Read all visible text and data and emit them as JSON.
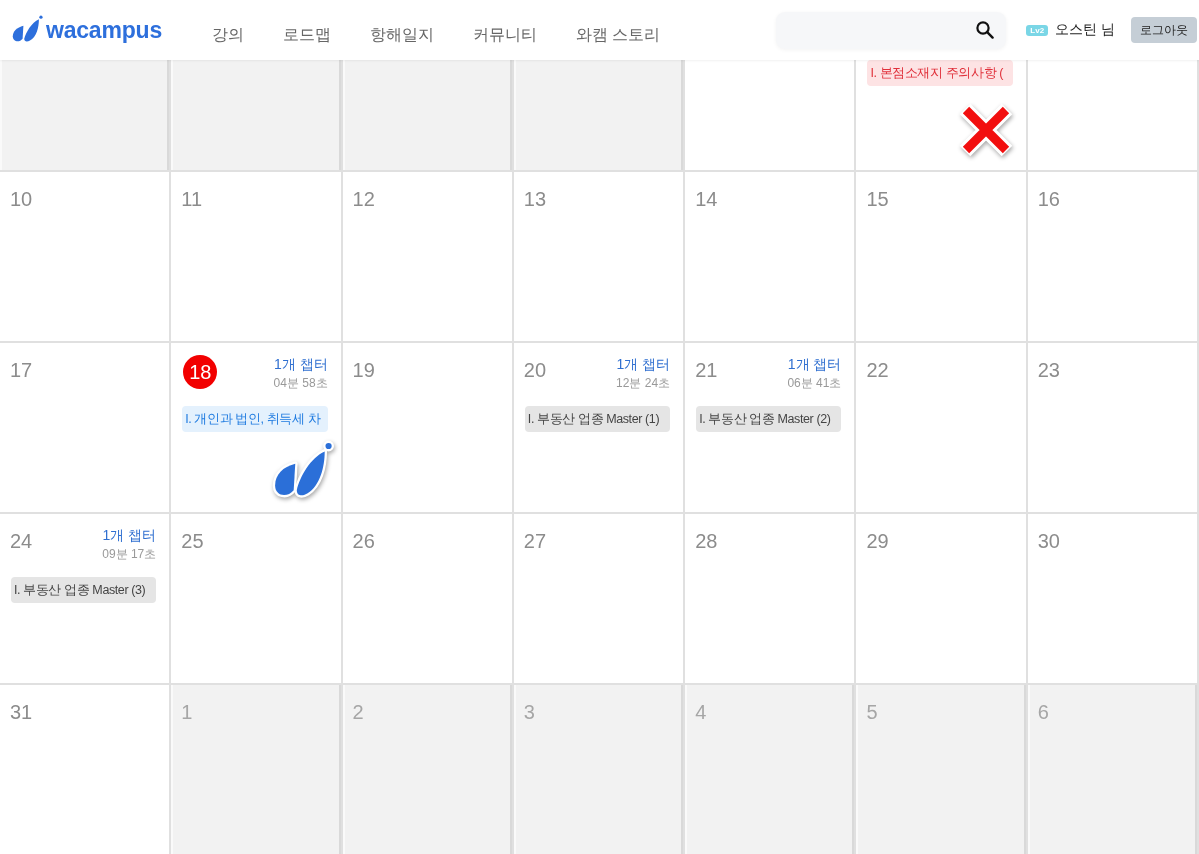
{
  "header": {
    "logo": "wacampus",
    "nav": [
      {
        "label": "강의",
        "selected": false
      },
      {
        "label": "로드맵",
        "selected": false
      },
      {
        "label": "항해일지",
        "selected": false
      },
      {
        "label": "커뮤니티",
        "selected": false
      },
      {
        "label": "와캠 스토리",
        "selected": false
      }
    ],
    "user": {
      "badge": "Lv2",
      "name": "오스틴 님"
    },
    "logout": "로그아웃"
  },
  "calendar": {
    "weeks": [
      {
        "days": [
          {
            "outside": true
          },
          {
            "outside": true
          },
          {
            "outside": true
          },
          {
            "outside": true
          },
          {
            "outside": false
          },
          {
            "outside": false,
            "events": [
              {
                "title": "I. 본점소재지 주의사항 (",
                "kind": "missed"
              }
            ],
            "stamp": {
              "kind": "missed"
            }
          },
          {
            "outside": false
          }
        ]
      },
      {
        "days": [
          {
            "day": "10",
            "outside": false,
            "today": false
          },
          {
            "day": "11",
            "outside": false,
            "today": false
          },
          {
            "day": "12",
            "outside": false,
            "today": false
          },
          {
            "day": "13",
            "outside": false,
            "today": false
          },
          {
            "day": "14",
            "outside": false,
            "today": false
          },
          {
            "day": "15",
            "outside": false,
            "today": false
          },
          {
            "day": "16",
            "outside": false,
            "today": false
          }
        ]
      },
      {
        "days": [
          {
            "day": "17",
            "outside": false,
            "today": false
          },
          {
            "day": "18",
            "outside": false,
            "today": true,
            "chapters": "1개 챕터",
            "duration": "04분 58초",
            "events": [
              {
                "title": "I. 개인과 법인, 취득세 차",
                "kind": "current"
              }
            ],
            "stamp": {
              "kind": "done"
            }
          },
          {
            "day": "19",
            "outside": false,
            "today": false
          },
          {
            "day": "20",
            "outside": false,
            "today": false,
            "chapters": "1개 챕터",
            "duration": "12분 24초",
            "events": [
              {
                "title": "I. 부동산 업종 Master (1)",
                "kind": "done"
              }
            ]
          },
          {
            "day": "21",
            "outside": false,
            "today": false,
            "chapters": "1개 챕터",
            "duration": "06분 41초",
            "events": [
              {
                "title": "I. 부동산 업종 Master (2)",
                "kind": "done"
              }
            ]
          },
          {
            "day": "22",
            "outside": false,
            "today": false
          },
          {
            "day": "23",
            "outside": false,
            "today": false
          }
        ]
      },
      {
        "days": [
          {
            "day": "24",
            "outside": false,
            "today": false,
            "chapters": "1개 챕터",
            "duration": "09분 17초",
            "events": [
              {
                "title": "I. 부동산 업종 Master (3)",
                "kind": "done"
              }
            ]
          },
          {
            "day": "25",
            "outside": false,
            "today": false
          },
          {
            "day": "26",
            "outside": false,
            "today": false
          },
          {
            "day": "27",
            "outside": false,
            "today": false
          },
          {
            "day": "28",
            "outside": false,
            "today": false
          },
          {
            "day": "29",
            "outside": false,
            "today": false
          },
          {
            "day": "30",
            "outside": false,
            "today": false
          }
        ]
      },
      {
        "days": [
          {
            "day": "31",
            "outside": false,
            "today": false
          },
          {
            "day": "1",
            "outside": true,
            "today": false
          },
          {
            "day": "2",
            "outside": true,
            "today": false
          },
          {
            "day": "3",
            "outside": true,
            "today": false
          },
          {
            "day": "4",
            "outside": true,
            "today": false
          },
          {
            "day": "5",
            "outside": true,
            "today": false
          },
          {
            "day": "6",
            "outside": true,
            "today": false
          }
        ]
      }
    ]
  }
}
